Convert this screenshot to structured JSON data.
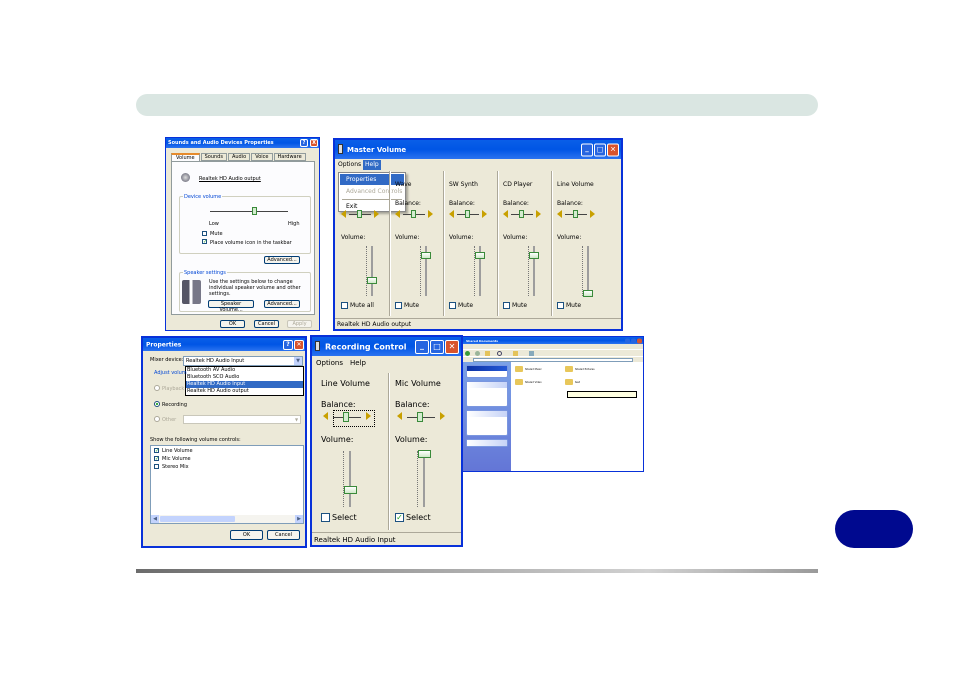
{
  "page": {
    "badge_text": ""
  },
  "sound_props": {
    "title": "Sounds and Audio Devices Properties",
    "help_btn": "?",
    "close_btn": "X",
    "tabs": [
      "Volume",
      "Sounds",
      "Audio",
      "Voice",
      "Hardware"
    ],
    "device": "Realtek HD Audio output",
    "device_volume_label": "Device volume",
    "low": "Low",
    "high": "High",
    "mute": "Mute",
    "place_icon": "Place volume icon in the taskbar",
    "advanced": "Advanced...",
    "speaker_settings_label": "Speaker settings",
    "speaker_text": "Use the settings below to change individual speaker volume and other settings.",
    "speaker_volume_btn": "Speaker Volume...",
    "speaker_advanced_btn": "Advanced...",
    "ok": "OK",
    "cancel": "Cancel",
    "apply": "Apply"
  },
  "master_volume": {
    "title": "Master Volume",
    "menu": [
      "Options",
      "Help"
    ],
    "dropdown": [
      "Properties",
      "Advanced Controls",
      "Exit"
    ],
    "columns": [
      {
        "name": "",
        "balance": "",
        "volume": "Volume:",
        "mute": "Mute all",
        "level": 0.3
      },
      {
        "name": "Wave",
        "balance": "Balance:",
        "volume": "Volume:",
        "mute": "Mute",
        "level": 0.8
      },
      {
        "name": "SW Synth",
        "balance": "Balance:",
        "volume": "Volume:",
        "mute": "Mute",
        "level": 0.8
      },
      {
        "name": "CD Player",
        "balance": "Balance:",
        "volume": "Volume:",
        "mute": "Mute",
        "level": 0.8
      },
      {
        "name": "Line Volume",
        "balance": "Balance:",
        "volume": "Volume:",
        "mute": "Mute",
        "level": 0.05
      }
    ],
    "status": "Realtek HD Audio output"
  },
  "properties": {
    "title": "Properties",
    "mixer_label": "Mixer device:",
    "mixer_value": "Realtek HD Audio Input",
    "options": [
      "Bluetooth AV Audio",
      "Bluetooth SCO Audio",
      "Realtek HD Audio Input",
      "Realtek HD Audio output"
    ],
    "selected_option": 2,
    "adjust_label": "Adjust volum",
    "playback": "Playback",
    "recording": "Recording",
    "other": "Other",
    "show_label": "Show the following volume controls:",
    "controls": [
      {
        "label": "Line Volume",
        "checked": true
      },
      {
        "label": "Mic Volume",
        "checked": true
      },
      {
        "label": "Stereo Mix",
        "checked": false
      }
    ],
    "ok": "OK",
    "cancel": "Cancel"
  },
  "recording": {
    "title": "Recording Control",
    "menu": [
      "Options",
      "Help"
    ],
    "columns": [
      {
        "name": "Line Volume",
        "balance": "Balance:",
        "volume": "Volume:",
        "select": "Select",
        "checked": false,
        "level": 0.3
      },
      {
        "name": "Mic Volume",
        "balance": "Balance:",
        "volume": "Volume:",
        "select": "Select",
        "checked": true,
        "level": 0.95
      }
    ],
    "status": "Realtek HD Audio Input"
  },
  "explorer": {
    "title": "Shared Documents",
    "folders": [
      "Shared Music",
      "Shared Pictures",
      "Shared Video",
      "test"
    ]
  }
}
